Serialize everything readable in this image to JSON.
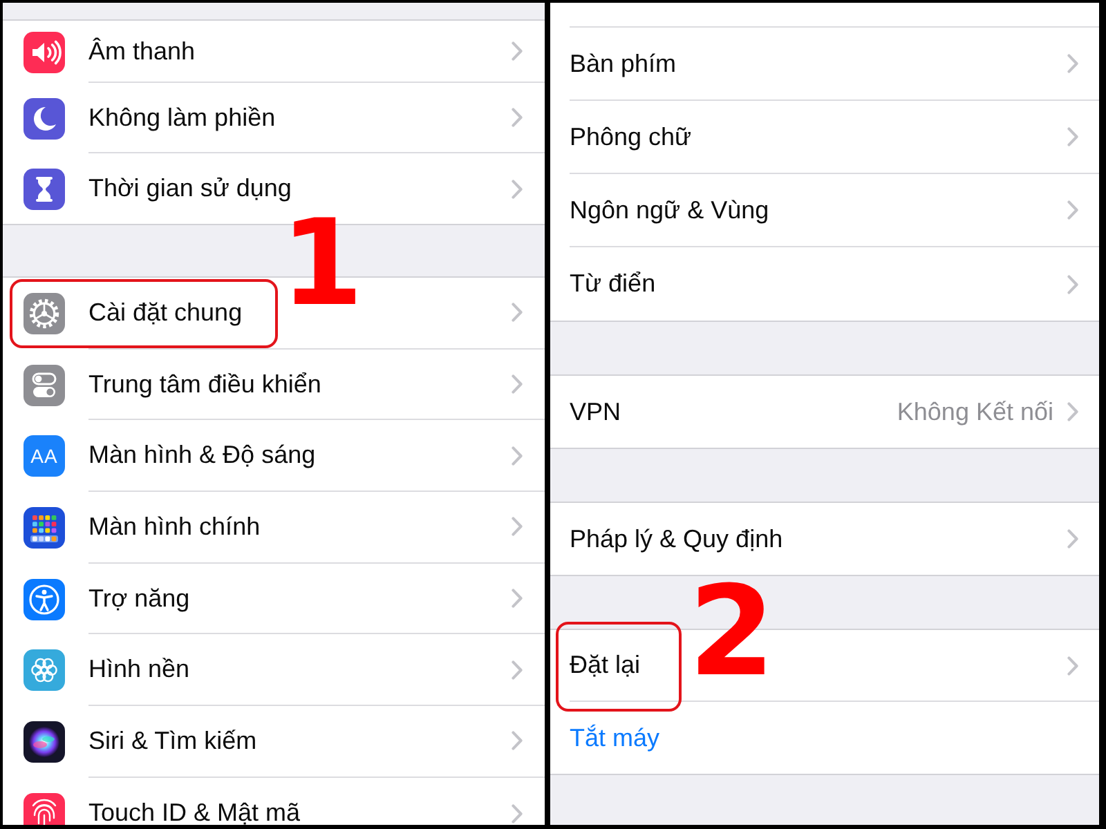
{
  "screens": [
    {
      "groups": [
        {
          "items": [
            {
              "label": "Âm thanh",
              "kind": "link",
              "highlighted": false
            },
            {
              "label": "Không làm phiền",
              "kind": "link",
              "highlighted": false
            },
            {
              "label": "Thời gian sử dụng",
              "kind": "link",
              "highlighted": false
            }
          ]
        },
        {
          "items": [
            {
              "label": "Cài đặt chung",
              "kind": "link",
              "highlighted": true,
              "marker": "1"
            },
            {
              "label": "Trung tâm điều khiển",
              "kind": "link",
              "highlighted": false
            },
            {
              "label": "Màn hình & Độ sáng",
              "kind": "link",
              "highlighted": false,
              "icon_text": "AA"
            },
            {
              "label": "Màn hình chính",
              "kind": "link",
              "highlighted": false
            },
            {
              "label": "Trợ năng",
              "kind": "link",
              "highlighted": false
            },
            {
              "label": "Hình nền",
              "kind": "link",
              "highlighted": false
            },
            {
              "label": "Siri & Tìm kiếm",
              "kind": "link",
              "highlighted": false
            },
            {
              "label": "Touch ID & Mật mã",
              "kind": "link",
              "highlighted": false
            }
          ]
        }
      ]
    },
    {
      "groups": [
        {
          "items": [
            {
              "label": "Bàn phím",
              "kind": "link",
              "highlighted": false
            },
            {
              "label": "Phông chữ",
              "kind": "link",
              "highlighted": false
            },
            {
              "label": "Ngôn ngữ & Vùng",
              "kind": "link",
              "highlighted": false
            },
            {
              "label": "Từ điển",
              "kind": "link",
              "highlighted": false
            }
          ]
        },
        {
          "items": [
            {
              "label": "VPN",
              "kind": "link",
              "highlighted": false,
              "value": "Không Kết nối"
            }
          ]
        },
        {
          "items": [
            {
              "label": "Pháp lý & Quy định",
              "kind": "link",
              "highlighted": false
            }
          ]
        },
        {
          "items": [
            {
              "label": "Đặt lại",
              "kind": "link",
              "highlighted": true,
              "marker": "2"
            },
            {
              "label": "Tắt máy",
              "kind": "action",
              "highlighted": false
            }
          ]
        }
      ]
    }
  ]
}
